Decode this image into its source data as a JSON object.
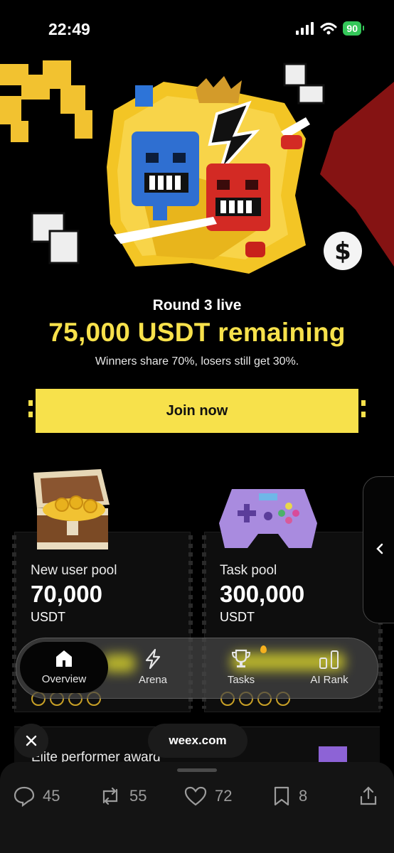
{
  "status_bar": {
    "time": "22:49",
    "battery": "90"
  },
  "hero": {
    "round": "Round 3 live",
    "remaining": "75,000 USDT remaining",
    "subline": "Winners share 70%, losers still get 30%.",
    "join_label": "Join now"
  },
  "pools": [
    {
      "label": "New user pool",
      "value": "70,000",
      "unit": "USDT",
      "icon": "treasure-chest-icon"
    },
    {
      "label": "Task pool",
      "value": "300,000",
      "unit": "USDT",
      "icon": "game-controller-icon"
    }
  ],
  "nav": {
    "items": [
      {
        "label": "Overview",
        "icon": "home-icon",
        "active": true
      },
      {
        "label": "Arena",
        "icon": "lightning-icon"
      },
      {
        "label": "Tasks",
        "icon": "trophy-icon"
      },
      {
        "label": "AI Rank",
        "icon": "bar-chart-icon"
      }
    ]
  },
  "elite": {
    "label": "Elite performer award"
  },
  "browser": {
    "url": "weex.com"
  },
  "actions": {
    "replies": "45",
    "reposts": "55",
    "likes": "72",
    "bookmarks": "8"
  },
  "colors": {
    "accent": "#f7e14b",
    "background": "#000000",
    "battery": "#34c759"
  }
}
